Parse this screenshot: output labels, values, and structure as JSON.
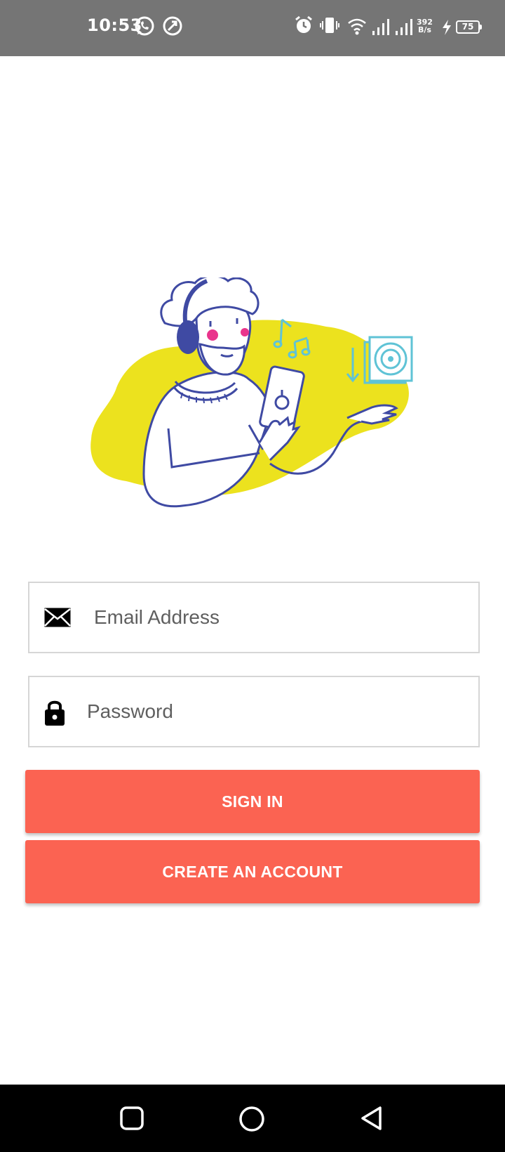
{
  "status_bar": {
    "time": "10:53",
    "net_speed_value": "392",
    "net_speed_unit": "B/s",
    "battery_level": "75",
    "icons": [
      "whatsapp-icon",
      "sync-icon",
      "alarm-icon",
      "vibrate-icon",
      "wifi-icon",
      "signal-icon",
      "signal-icon",
      "charging-icon",
      "battery-icon"
    ]
  },
  "login": {
    "email_placeholder": "Email Address",
    "password_placeholder": "Password",
    "sign_in_label": "SIGN IN",
    "create_account_label": "CREATE AN ACCOUNT"
  },
  "nav_bar": {
    "icons": [
      "recents-icon",
      "home-icon",
      "back-icon"
    ]
  },
  "colors": {
    "accent": "#fb6352",
    "status_bar_bg": "#757575",
    "illustration_yellow": "#ece21e",
    "illustration_blue": "#3f4aa3",
    "illustration_teal": "#5fc3d6",
    "input_border": "#d6d6d6"
  }
}
